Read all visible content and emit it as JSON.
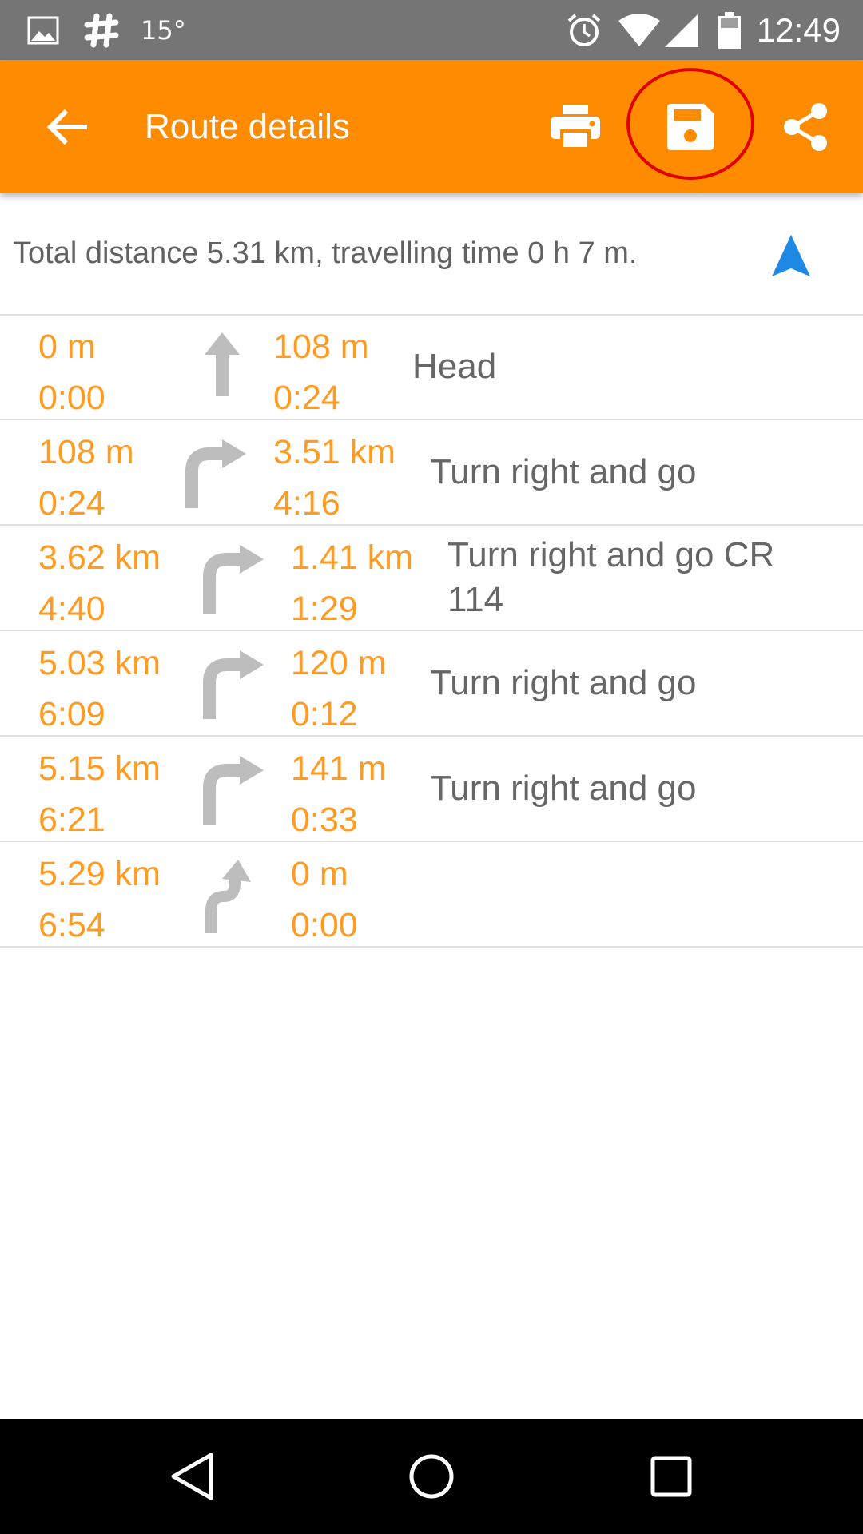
{
  "status_bar": {
    "temperature": "15°",
    "time": "12:49",
    "icons": [
      "gallery-icon",
      "slack-icon",
      "alarm-icon",
      "wifi-icon",
      "signal-icon",
      "battery-icon"
    ]
  },
  "app_bar": {
    "title": "Route details",
    "back_icon": "back-arrow-icon",
    "actions": [
      "print-icon",
      "save-icon",
      "share-icon"
    ],
    "color": "#ff8c00"
  },
  "summary": {
    "text": "Total distance 5.31 km, travelling time 0 h 7 m.",
    "icon": "navigation-arrow-icon",
    "icon_color": "#1e88e5"
  },
  "steps": [
    {
      "dist_from_start": "0 m",
      "time_from_start": "0:00",
      "icon": "straight-arrow-icon",
      "segment_dist": "108 m",
      "segment_time": "0:24",
      "instruction": "Head"
    },
    {
      "dist_from_start": "108 m",
      "time_from_start": "0:24",
      "icon": "turn-right-icon",
      "segment_dist": "3.51 km",
      "segment_time": "4:16",
      "instruction": "Turn right and go"
    },
    {
      "dist_from_start": "3.62 km",
      "time_from_start": "4:40",
      "icon": "turn-right-icon",
      "segment_dist": "1.41 km",
      "segment_time": "1:29",
      "instruction": "Turn right and go CR 114"
    },
    {
      "dist_from_start": "5.03 km",
      "time_from_start": "6:09",
      "icon": "turn-right-icon",
      "segment_dist": "120 m",
      "segment_time": "0:12",
      "instruction": "Turn right and go"
    },
    {
      "dist_from_start": "5.15 km",
      "time_from_start": "6:21",
      "icon": "turn-right-icon",
      "segment_dist": "141 m",
      "segment_time": "0:33",
      "instruction": "Turn right and go"
    },
    {
      "dist_from_start": "5.29 km",
      "time_from_start": "6:54",
      "icon": "slight-right-icon",
      "segment_dist": "0 m",
      "segment_time": "0:00",
      "instruction": ""
    }
  ],
  "nav_bar": {
    "buttons": [
      "back-triangle-icon",
      "home-circle-icon",
      "recents-square-icon"
    ]
  },
  "colors": {
    "accent": "#ff8c00",
    "value_text": "#ff9b1f",
    "instruction_text": "#666666",
    "annotation_ring": "#e00000"
  }
}
